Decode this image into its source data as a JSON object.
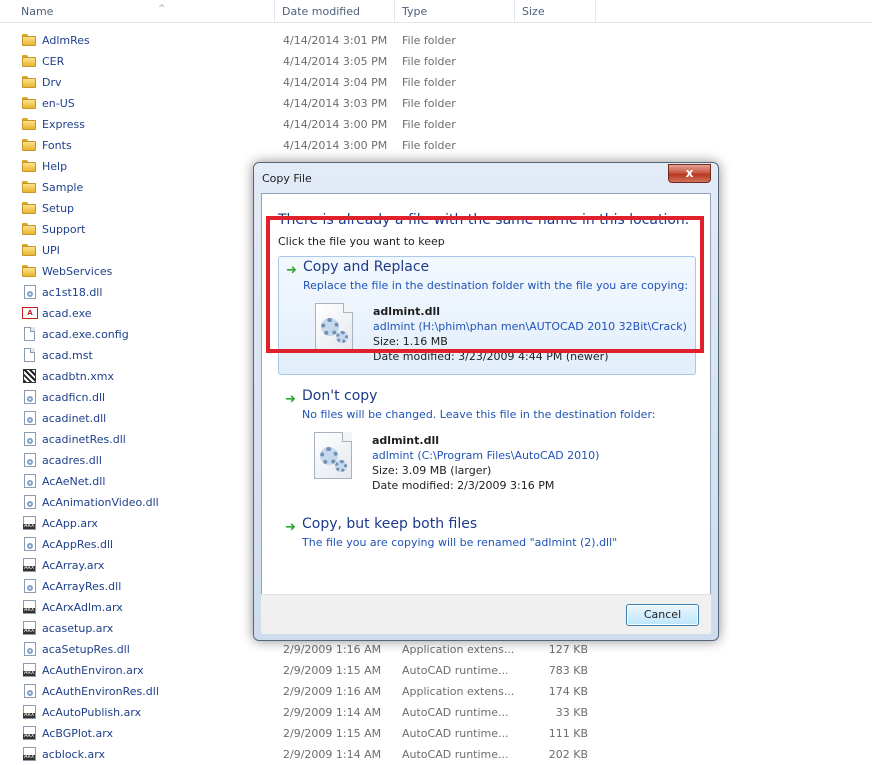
{
  "columns": {
    "name": "Name",
    "date": "Date modified",
    "type": "Type",
    "size": "Size"
  },
  "files": [
    {
      "name": "AdlmRes",
      "date": "4/14/2014 3:01 PM",
      "type": "File folder",
      "size": "",
      "icon": "folder"
    },
    {
      "name": "CER",
      "date": "4/14/2014 3:05 PM",
      "type": "File folder",
      "size": "",
      "icon": "folder"
    },
    {
      "name": "Drv",
      "date": "4/14/2014 3:04 PM",
      "type": "File folder",
      "size": "",
      "icon": "folder"
    },
    {
      "name": "en-US",
      "date": "4/14/2014 3:03 PM",
      "type": "File folder",
      "size": "",
      "icon": "folder"
    },
    {
      "name": "Express",
      "date": "4/14/2014 3:00 PM",
      "type": "File folder",
      "size": "",
      "icon": "folder"
    },
    {
      "name": "Fonts",
      "date": "4/14/2014 3:00 PM",
      "type": "File folder",
      "size": "",
      "icon": "folder"
    },
    {
      "name": "Help",
      "date": "",
      "type": "",
      "size": "",
      "icon": "folder"
    },
    {
      "name": "Sample",
      "date": "",
      "type": "",
      "size": "",
      "icon": "folder"
    },
    {
      "name": "Setup",
      "date": "",
      "type": "",
      "size": "",
      "icon": "folder"
    },
    {
      "name": "Support",
      "date": "",
      "type": "",
      "size": "",
      "icon": "folder"
    },
    {
      "name": "UPI",
      "date": "",
      "type": "",
      "size": "",
      "icon": "folder"
    },
    {
      "name": "WebServices",
      "date": "",
      "type": "",
      "size": "",
      "icon": "folder"
    },
    {
      "name": "ac1st18.dll",
      "date": "",
      "type": "",
      "size": "",
      "icon": "dll"
    },
    {
      "name": "acad.exe",
      "date": "",
      "type": "",
      "size": "",
      "icon": "exe"
    },
    {
      "name": "acad.exe.config",
      "date": "",
      "type": "",
      "size": "",
      "icon": "file"
    },
    {
      "name": "acad.mst",
      "date": "",
      "type": "",
      "size": "",
      "icon": "file"
    },
    {
      "name": "acadbtn.xmx",
      "date": "",
      "type": "",
      "size": "",
      "icon": "xmx"
    },
    {
      "name": "acadficn.dll",
      "date": "",
      "type": "",
      "size": "",
      "icon": "dll"
    },
    {
      "name": "acadinet.dll",
      "date": "",
      "type": "",
      "size": "",
      "icon": "dll"
    },
    {
      "name": "acadinetRes.dll",
      "date": "",
      "type": "",
      "size": "",
      "icon": "dll"
    },
    {
      "name": "acadres.dll",
      "date": "",
      "type": "",
      "size": "",
      "icon": "dll"
    },
    {
      "name": "AcAeNet.dll",
      "date": "",
      "type": "",
      "size": "",
      "icon": "dll"
    },
    {
      "name": "AcAnimationVideo.dll",
      "date": "",
      "type": "",
      "size": "",
      "icon": "dll"
    },
    {
      "name": "AcApp.arx",
      "date": "",
      "type": "",
      "size": "",
      "icon": "arx"
    },
    {
      "name": "AcAppRes.dll",
      "date": "",
      "type": "",
      "size": "",
      "icon": "dll"
    },
    {
      "name": "AcArray.arx",
      "date": "",
      "type": "",
      "size": "",
      "icon": "arx"
    },
    {
      "name": "AcArrayRes.dll",
      "date": "",
      "type": "",
      "size": "",
      "icon": "dll"
    },
    {
      "name": "AcArxAdlm.arx",
      "date": "",
      "type": "",
      "size": "",
      "icon": "arx"
    },
    {
      "name": "acasetup.arx",
      "date": "",
      "type": "",
      "size": "",
      "icon": "arx"
    },
    {
      "name": "acaSetupRes.dll",
      "date": "2/9/2009 1:16 AM",
      "type": "Application extens...",
      "size": "127 KB",
      "icon": "dll"
    },
    {
      "name": "AcAuthEnviron.arx",
      "date": "2/9/2009 1:15 AM",
      "type": "AutoCAD runtime...",
      "size": "783 KB",
      "icon": "arx"
    },
    {
      "name": "AcAuthEnvironRes.dll",
      "date": "2/9/2009 1:16 AM",
      "type": "Application extens...",
      "size": "174 KB",
      "icon": "dll"
    },
    {
      "name": "AcAutoPublish.arx",
      "date": "2/9/2009 1:14 AM",
      "type": "AutoCAD runtime...",
      "size": "33 KB",
      "icon": "arx"
    },
    {
      "name": "AcBGPlot.arx",
      "date": "2/9/2009 1:15 AM",
      "type": "AutoCAD runtime...",
      "size": "111 KB",
      "icon": "arx"
    },
    {
      "name": "acblock.arx",
      "date": "2/9/2009 1:14 AM",
      "type": "AutoCAD runtime...",
      "size": "202 KB",
      "icon": "arx"
    }
  ],
  "dialog": {
    "title": "Copy File",
    "close_glyph": "x",
    "headline": "There is already a file with the same name in this location.",
    "subline": "Click the file you want to keep",
    "options": [
      {
        "title": "Copy and Replace",
        "desc": "Replace the file in the destination folder with the file you are copying:",
        "file": {
          "name": "adlmint.dll",
          "path": "adlmint (H:\\phim\\phan men\\AUTOCAD 2010 32Bit\\Crack)",
          "size": "Size: 1.16 MB",
          "date": "Date modified: 3/23/2009 4:44 PM (newer)"
        }
      },
      {
        "title": "Don't copy",
        "desc": "No files will be changed. Leave this file in the destination folder:",
        "file": {
          "name": "adlmint.dll",
          "path": "adlmint (C:\\Program Files\\AutoCAD 2010)",
          "size": "Size: 3.09 MB (larger)",
          "date": "Date modified: 2/3/2009 3:16 PM"
        }
      },
      {
        "title": "Copy, but keep both files",
        "desc": "The file you are copying will be renamed \"adlmint (2).dll\""
      }
    ],
    "cancel_label": "Cancel"
  },
  "colors": {
    "highlight_box": "#e0202a",
    "link_blue": "#1f53b7",
    "heading_blue": "#1c3a8a"
  }
}
